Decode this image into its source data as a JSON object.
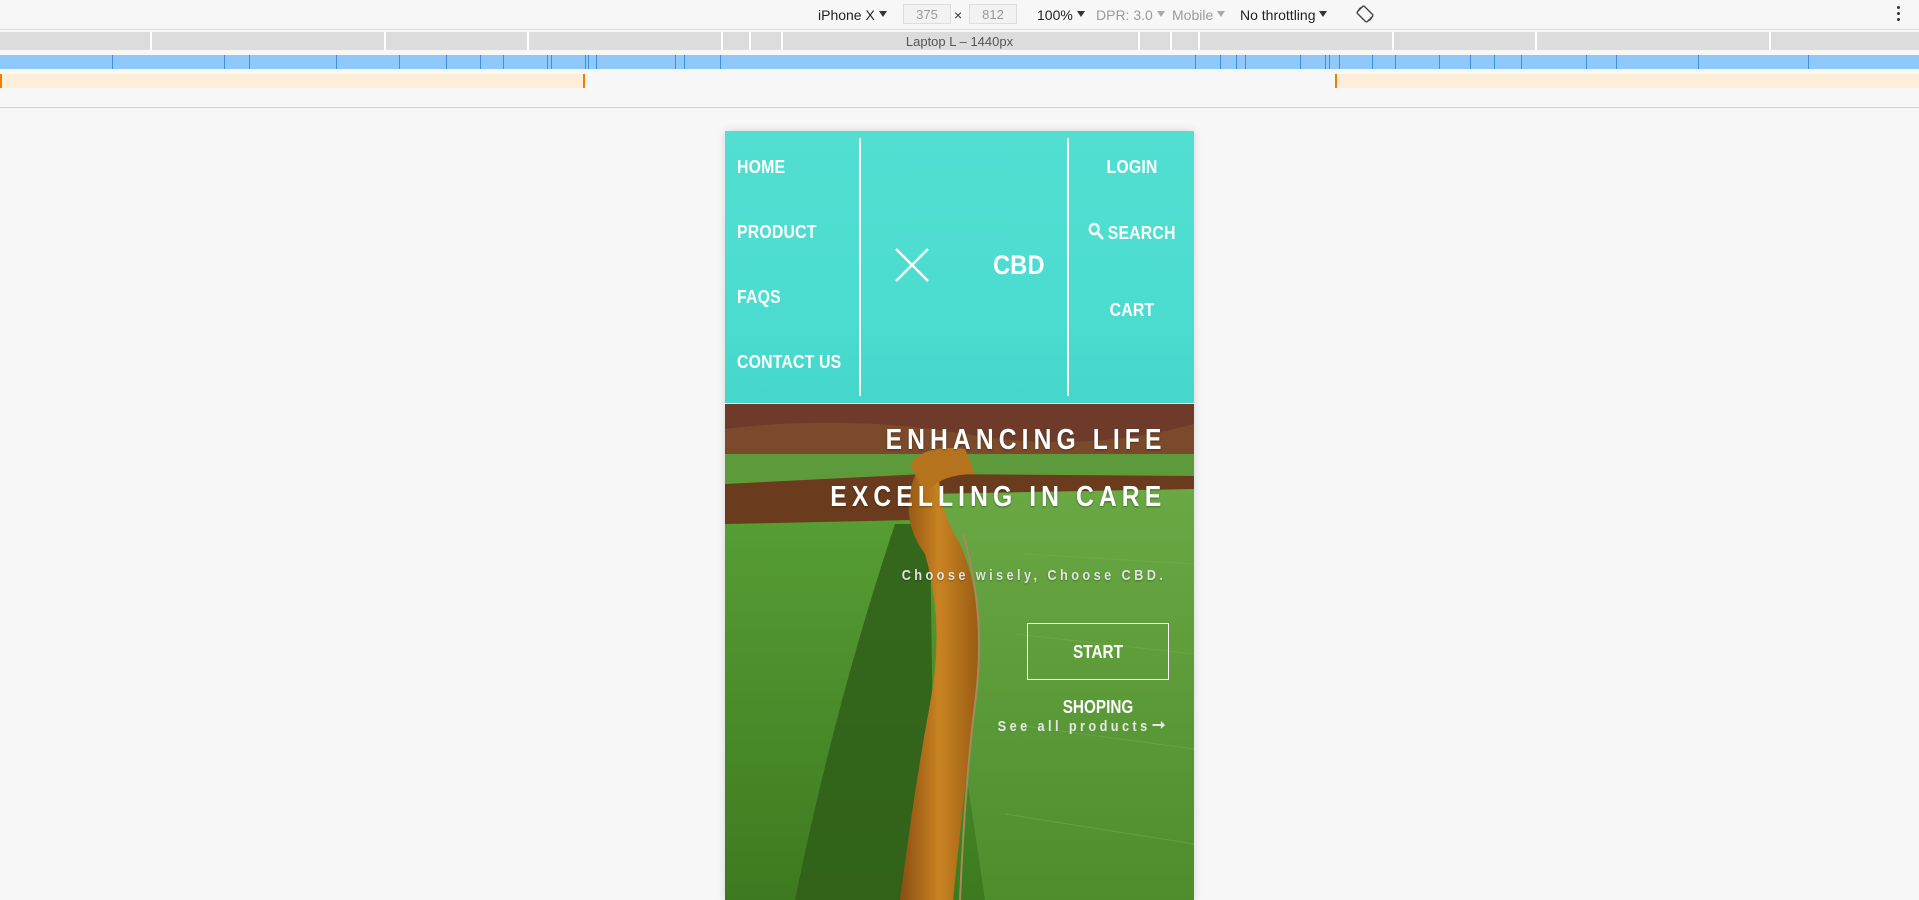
{
  "devtools": {
    "device": "iPhone X",
    "width": "375",
    "height": "812",
    "times": "×",
    "zoom": "100%",
    "dpr": "DPR: 3.0",
    "mode": "Mobile",
    "throttling": "No throttling",
    "media_label": "Laptop L – 1440px",
    "icons": [
      "rotate-icon",
      "kebab-icon"
    ]
  },
  "site": {
    "nav_left": [
      "HOME",
      "PRODUCT",
      "FAQS",
      "CONTACT US"
    ],
    "brand": "CBD",
    "nav_right": {
      "login": "LOGIN",
      "search": "SEARCH",
      "cart": "CART"
    },
    "icons": [
      "close-icon",
      "search-icon",
      "arrow-right-icon"
    ]
  },
  "hero": {
    "title_line1": "ENHANCING LIFE",
    "title_line2": "EXCELLING IN CARE",
    "tagline": "Choose wisely, Choose CBD.",
    "cta": "START SHOPING",
    "see_all": "See all products"
  },
  "colors": {
    "header_bg": "#4bdccf",
    "text_white": "#ffffff",
    "devtools_bg": "#f7f7f7",
    "mq_blue": "#8fc9f9",
    "mq_orange": "#fdeed8"
  }
}
